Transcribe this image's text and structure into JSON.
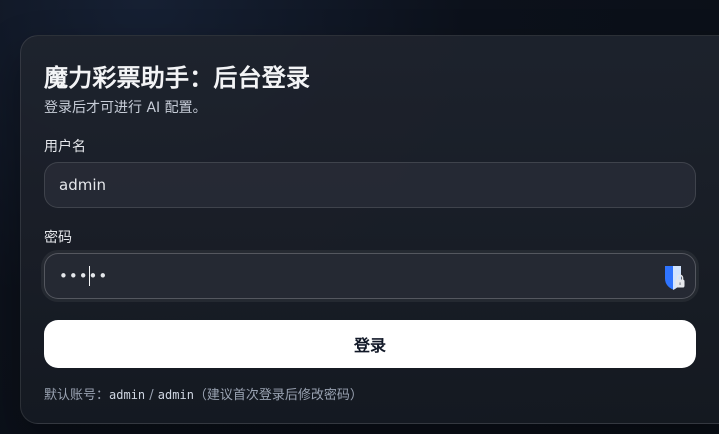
{
  "login": {
    "title": "魔力彩票助手：后台登录",
    "subtitle": "登录后才可进行 AI 配置。",
    "username_label": "用户名",
    "username_value": "admin",
    "password_label": "密码",
    "password_value": "•••••",
    "submit_label": "登录",
    "hint_prefix": "默认账号：",
    "hint_user": "admin",
    "hint_sep": " / ",
    "hint_pass": "admin",
    "hint_suffix": "（建议首次登录后修改密码）"
  },
  "icons": {
    "password_manager": "shield-lock-icon"
  },
  "colors": {
    "page_bg": "#0c111b",
    "card_bg": "#1f242e",
    "button_bg": "#ffffff",
    "icon_blue": "#2f74ff"
  }
}
